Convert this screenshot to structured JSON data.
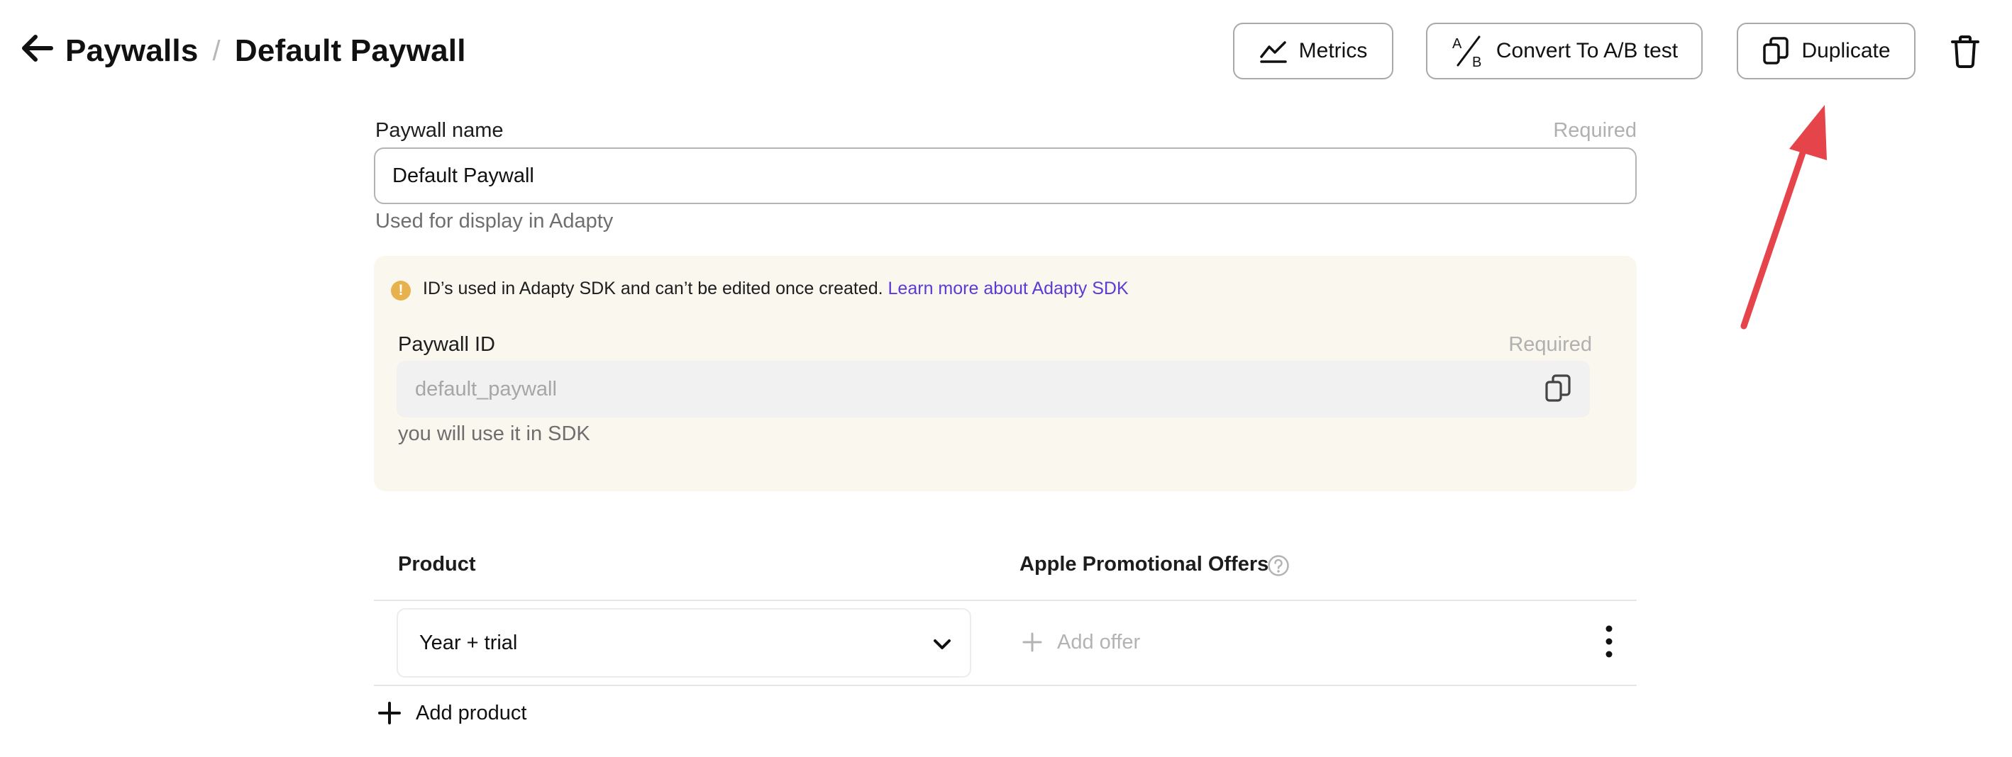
{
  "header": {
    "breadcrumb_root": "Paywalls",
    "breadcrumb_separator": "/",
    "breadcrumb_current": "Default Paywall",
    "metrics_label": "Metrics",
    "ab_icon_top": "A",
    "ab_icon_bottom": "B",
    "ab_label": "Convert To A/B test",
    "duplicate_label": "Duplicate"
  },
  "form": {
    "name_label": "Paywall name",
    "name_required": "Required",
    "name_value": "Default Paywall",
    "name_hint": "Used for display in Adapty",
    "sdk_notice": "ID’s used in Adapty SDK and can’t be edited once created.",
    "sdk_link": "Learn more about Adapty SDK",
    "id_label": "Paywall ID",
    "id_required": "Required",
    "id_value": "default_paywall",
    "id_hint": "you will use it in SDK"
  },
  "products": {
    "col_product": "Product",
    "col_offers": "Apple Promotional Offers",
    "rows": [
      {
        "product": "Year + trial",
        "offer_action": "Add offer"
      }
    ],
    "add_product_label": "Add product"
  },
  "colors": {
    "annotation_arrow": "#e5444a",
    "link": "#5a3bd6",
    "warning": "#e7b24e",
    "panel_bg": "#faf7ee"
  },
  "icons": [
    "back-arrow-icon",
    "chart-line-icon",
    "ab-test-icon",
    "copy-icon",
    "trash-icon",
    "warning-icon",
    "help-icon",
    "chevron-down-icon",
    "plus-icon",
    "more-vertical-icon"
  ]
}
